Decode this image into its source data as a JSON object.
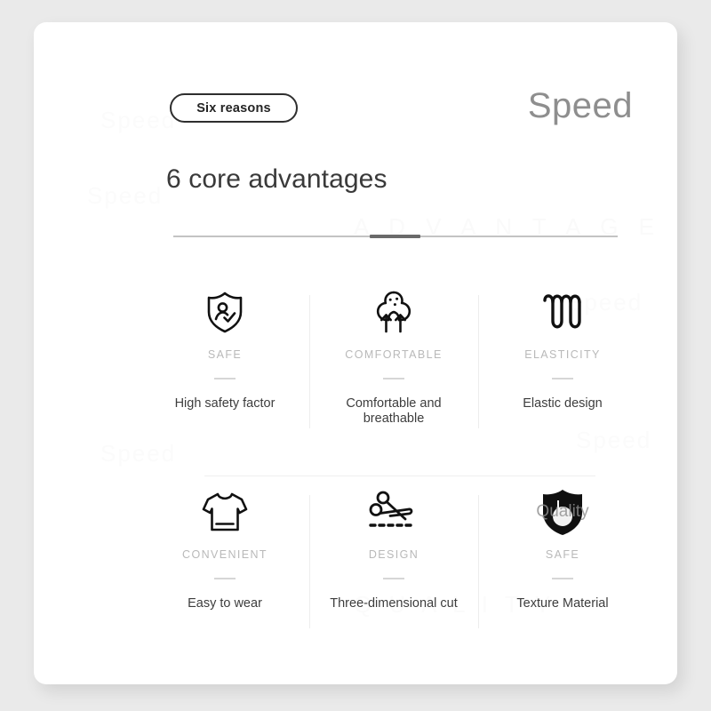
{
  "card": {
    "badge": {
      "label": "Six reasons"
    },
    "brand": "Speed",
    "headline": "6 core advantages"
  },
  "watermarks": [
    "Speed",
    "Speed",
    "A D V A N T A G E",
    "Speed",
    "Speed",
    "Speed",
    "Q U A L I T Y"
  ],
  "features": [
    {
      "icon": "shield-person-check-icon",
      "caption": "SAFE",
      "description": "High safety factor"
    },
    {
      "icon": "cotton-arrows-icon",
      "caption": "COMFORTABLE",
      "description": "Comfortable and breathable"
    },
    {
      "icon": "elastic-spring-icon",
      "caption": "ELASTICITY",
      "description": "Elastic design"
    },
    {
      "icon": "tshirt-icon",
      "caption": "CONVENIENT",
      "description": "Easy to wear"
    },
    {
      "icon": "scissors-cut-icon",
      "caption": "DESIGN",
      "description": "Three-dimensional cut"
    },
    {
      "icon": "quality-shield-icon",
      "caption": "SAFE",
      "description": "Texture Material",
      "overlay_text": "Quality"
    }
  ],
  "colors": {
    "page_background": "#eaeaea",
    "card_background": "#ffffff",
    "badge_border": "#2e2e2e",
    "headline_text": "#3a3a3a",
    "brand_text": "#8e8e8e",
    "caption_text": "#b9b9b9",
    "description_text": "#3d3d3d",
    "rule": "#c3c3c3",
    "rule_accent": "#6a6a6a",
    "divider": "#ededed",
    "icon_stroke": "#111111"
  }
}
